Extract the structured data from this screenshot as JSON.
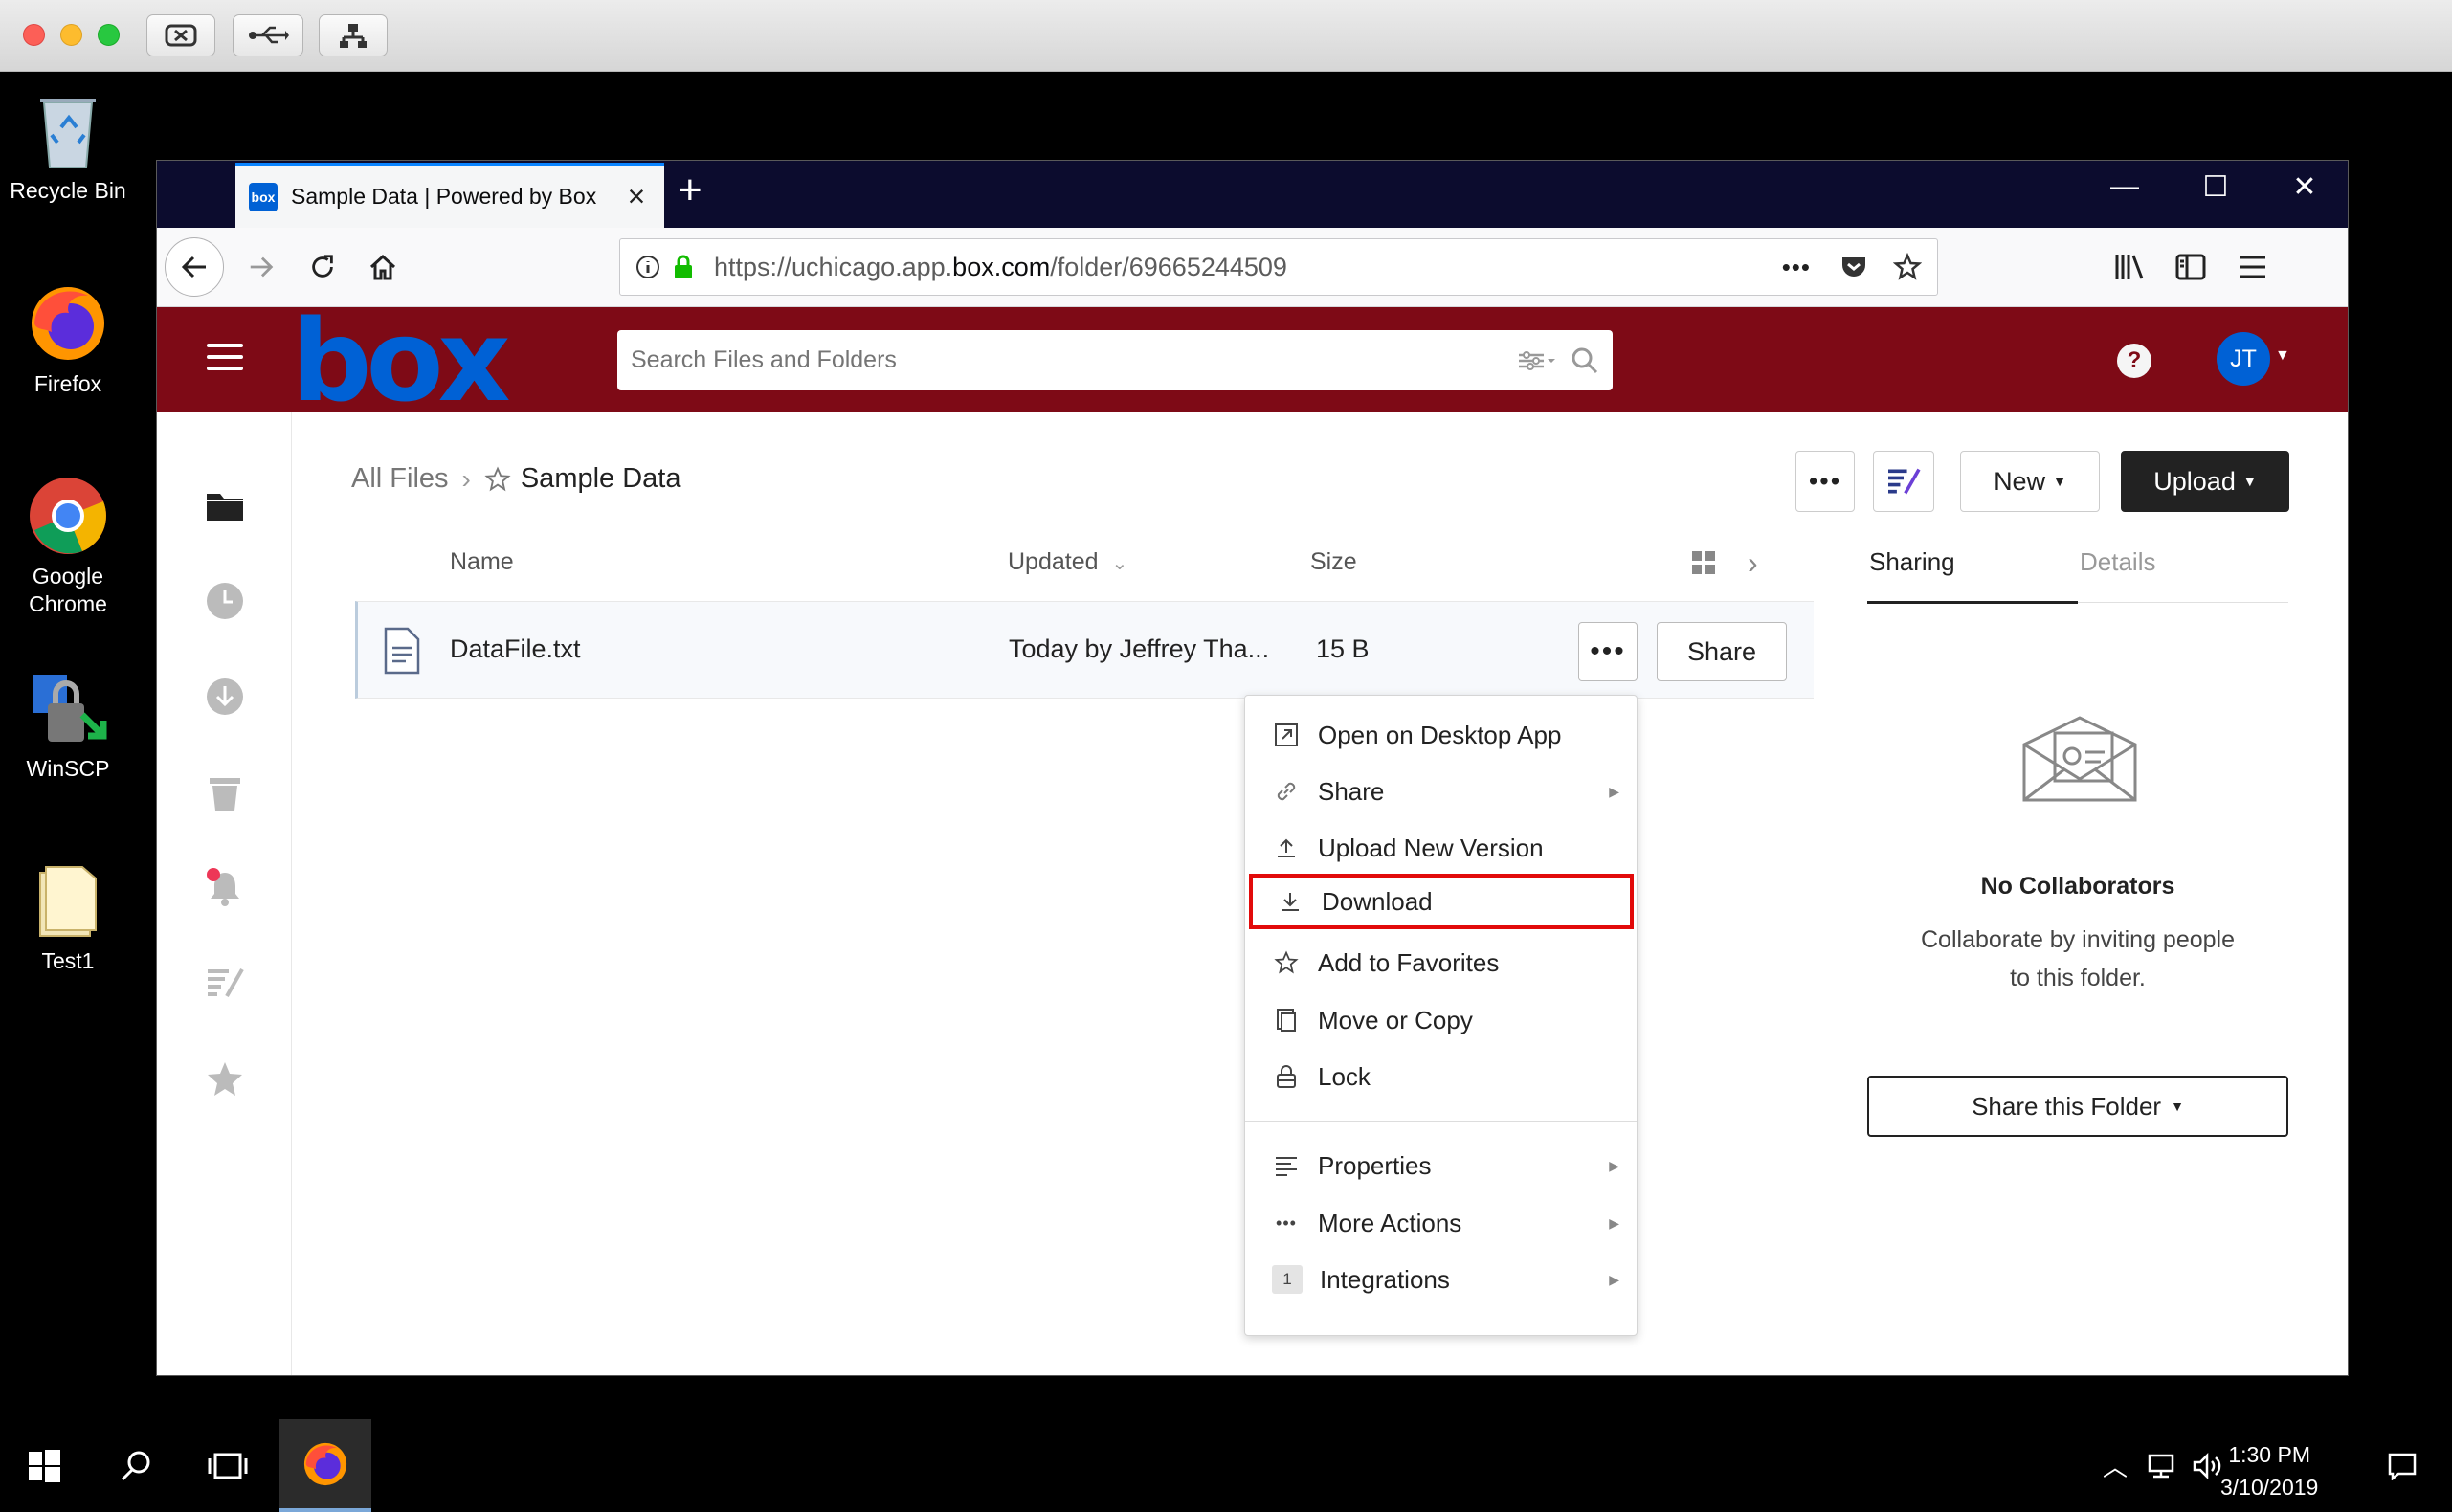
{
  "desktop": {
    "icons": [
      {
        "label": "Recycle Bin"
      },
      {
        "label": "Firefox"
      },
      {
        "label": "Google Chrome"
      },
      {
        "label": "WinSCP"
      },
      {
        "label": "Test1"
      }
    ]
  },
  "browser": {
    "tab_title": "Sample Data | Powered by Box",
    "tab_favicon": "box",
    "url_prefix": "https://uchicago.app.",
    "url_domain": "box.com",
    "url_path": "/folder/69665244509"
  },
  "box": {
    "logo": "box",
    "search_placeholder": "Search Files and Folders",
    "help_label": "?",
    "avatar_initials": "JT",
    "colors": {
      "header": "#7e0a16",
      "brand": "#0061d5",
      "highlight": "#e20a0a"
    }
  },
  "breadcrumb": {
    "root": "All Files",
    "current": "Sample Data"
  },
  "toolbar": {
    "more_label": "•••",
    "new_label": "New",
    "upload_label": "Upload"
  },
  "list": {
    "columns": {
      "name": "Name",
      "updated": "Updated",
      "size": "Size"
    },
    "rows": [
      {
        "name": "DataFile.txt",
        "updated": "Today by Jeffrey Tha...",
        "size": "15 B",
        "share_label": "Share"
      }
    ]
  },
  "context_menu": {
    "items": [
      {
        "label": "Open on Desktop App",
        "icon": "open-external-icon",
        "arrow": false
      },
      {
        "label": "Share",
        "icon": "link-icon",
        "arrow": true
      },
      {
        "label": "Upload New Version",
        "icon": "upload-icon",
        "arrow": false
      },
      {
        "label": "Download",
        "icon": "download-icon",
        "arrow": false
      },
      {
        "label": "Add to Favorites",
        "icon": "star-icon",
        "arrow": false
      },
      {
        "label": "Move or Copy",
        "icon": "copy-icon",
        "arrow": false
      },
      {
        "label": "Lock",
        "icon": "lock-icon",
        "arrow": false
      },
      {
        "label": "Properties",
        "icon": "properties-icon",
        "arrow": true
      },
      {
        "label": "More Actions",
        "icon": "ellipsis-icon",
        "arrow": true
      },
      {
        "label": "Integrations",
        "icon": "integrations-icon",
        "arrow": true,
        "badge": "1"
      }
    ]
  },
  "sidebar": {
    "tabs": [
      "Sharing",
      "Details"
    ],
    "empty_title": "No Collaborators",
    "empty_desc_line1": "Collaborate by inviting people",
    "empty_desc_line2": "to this folder.",
    "share_folder_label": "Share this Folder"
  },
  "taskbar": {
    "time": "1:30 PM",
    "date": "3/10/2019"
  }
}
